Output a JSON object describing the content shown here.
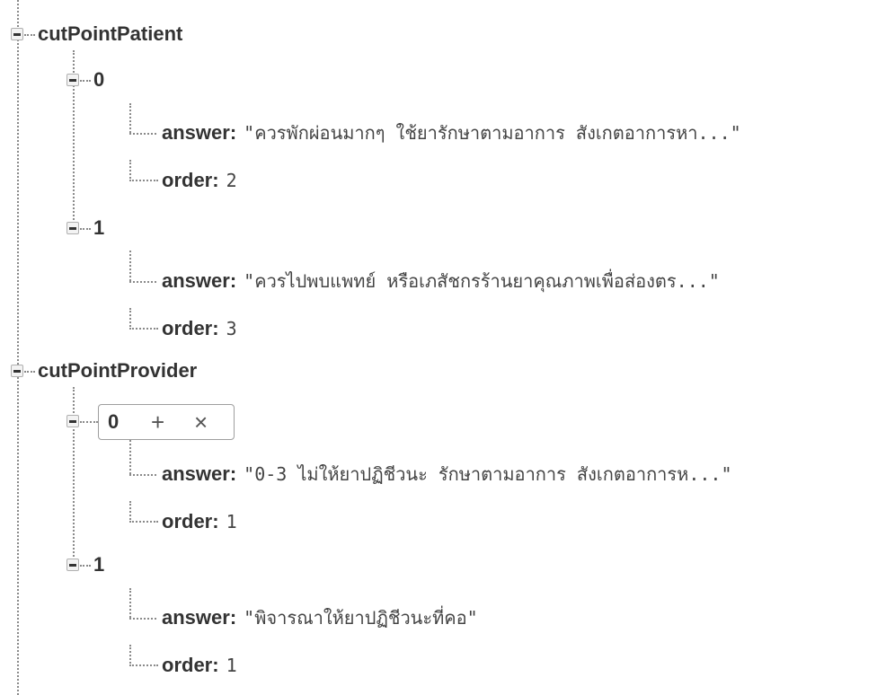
{
  "tree": {
    "cutPointPatient": {
      "key": "cutPointPatient",
      "items": [
        {
          "index": "0",
          "answer_key": "answer",
          "answer": "\"ควรพักผ่อนมากๆ ใช้ยารักษาตามอาการ สังเกตอาการหา...\"",
          "order_key": "order",
          "order": "2"
        },
        {
          "index": "1",
          "answer_key": "answer",
          "answer": "\"ควรไปพบแพทย์ หรือเภสัชกรร้านยาคุณภาพเพื่อส่องตร...\"",
          "order_key": "order",
          "order": "3"
        }
      ]
    },
    "cutPointProvider": {
      "key": "cutPointProvider",
      "items": [
        {
          "index": "0",
          "add_label": "+",
          "remove_label": "×",
          "answer_key": "answer",
          "answer": "\"0-3 ไม่ให้ยาปฏิชีวนะ รักษาตามอาการ สังเกตอาการห...\"",
          "order_key": "order",
          "order": "1"
        },
        {
          "index": "1",
          "answer_key": "answer",
          "answer": "\"พิจารณาให้ยาปฏิชีวนะที่คอ\"",
          "order_key": "order",
          "order": "1"
        }
      ]
    }
  },
  "colors": {
    "text": "#333333",
    "value": "#444444",
    "connector": "#8a8a8a"
  },
  "icons": {
    "collapse": "minus-box-icon",
    "add": "plus-icon",
    "remove": "close-icon"
  }
}
